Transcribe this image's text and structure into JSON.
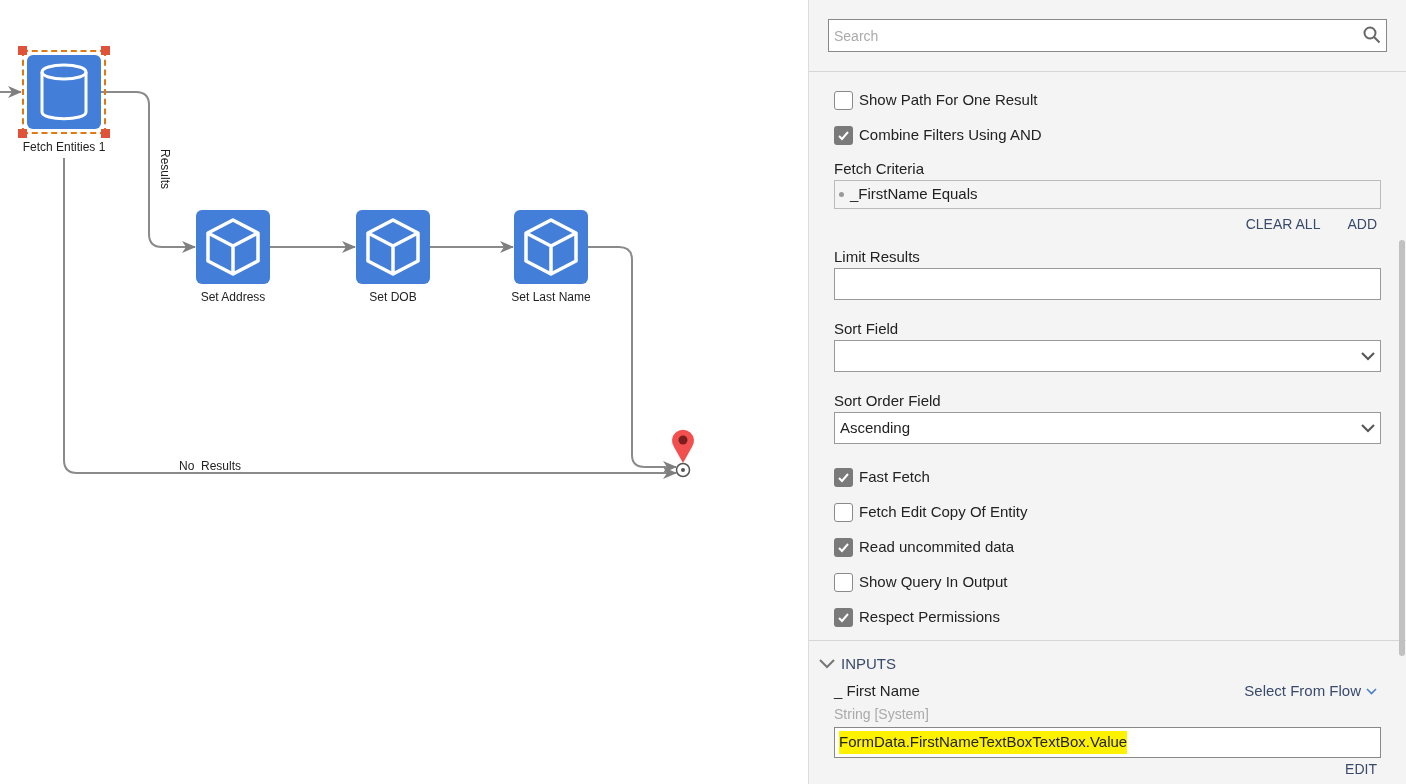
{
  "canvas": {
    "nodes": [
      {
        "label": "Fetch Entities 1",
        "kind": "database",
        "selected": true
      },
      {
        "label": "Set Address",
        "kind": "entity",
        "selected": false
      },
      {
        "label": "Set DOB",
        "kind": "entity",
        "selected": false
      },
      {
        "label": "Set Last Name",
        "kind": "entity",
        "selected": false
      }
    ],
    "path_labels": [
      "Results",
      "No  Results"
    ]
  },
  "panel": {
    "search": {
      "placeholder": "Search"
    },
    "settings": [
      {
        "kind": "checkbox",
        "label": "Show Path For One Result",
        "checked": false
      },
      {
        "kind": "checkbox",
        "label": "Combine Filters Using AND",
        "checked": true
      },
      {
        "kind": "list",
        "label": "Fetch Criteria",
        "items": [
          "_FirstName Equals"
        ],
        "actions": [
          "CLEAR ALL",
          "ADD"
        ]
      },
      {
        "kind": "text",
        "label": "Limit Results"
      },
      {
        "kind": "select",
        "label": "Sort Field"
      },
      {
        "kind": "select",
        "label": "Sort Order Field",
        "value": "Ascending"
      },
      {
        "kind": "checkbox",
        "label": "Fast Fetch",
        "checked": true
      },
      {
        "kind": "checkbox",
        "label": "Fetch Edit Copy Of Entity",
        "checked": false
      },
      {
        "kind": "checkbox",
        "label": "Read uncommited data",
        "checked": true
      },
      {
        "kind": "checkbox",
        "label": "Show Query In Output",
        "checked": false
      },
      {
        "kind": "checkbox",
        "label": "Respect Permissions",
        "checked": true
      }
    ],
    "inputs": {
      "title": "INPUTS",
      "expanded": true,
      "items": [
        {
          "name": "_ First Name",
          "source": "Select From Flow",
          "type": "String [System]",
          "value": "FormData.FirstNameTextBoxTextBox.Value",
          "highlighted": true,
          "action": "EDIT"
        }
      ]
    }
  }
}
